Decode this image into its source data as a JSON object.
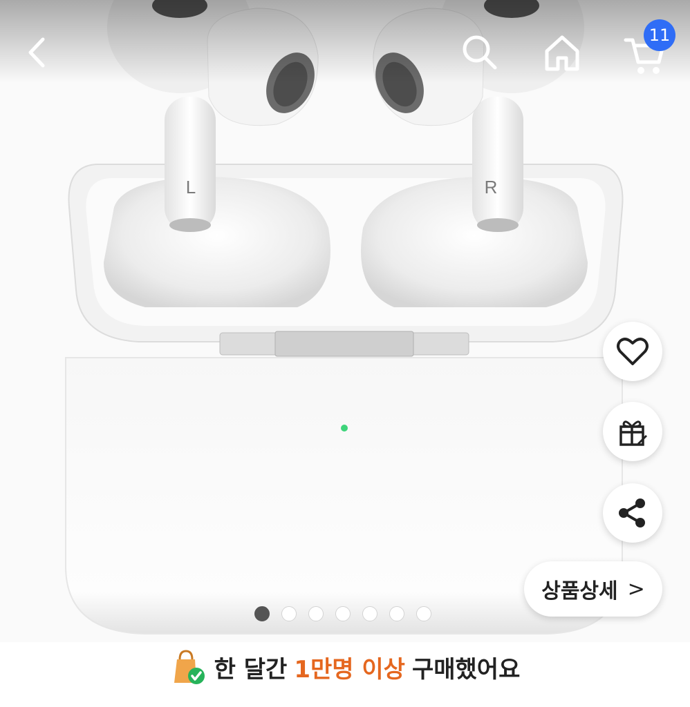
{
  "header": {
    "back_icon": "chevron-left-icon",
    "search_icon": "search-icon",
    "home_icon": "home-icon",
    "cart_icon": "cart-icon",
    "cart_count": "11"
  },
  "product_image": {
    "left_label": "L",
    "right_label": "R",
    "status_led_color": "#3ed47a"
  },
  "actions": {
    "wishlist_icon": "heart-icon",
    "gift_icon": "gift-icon",
    "share_icon": "share-icon",
    "detail_label": "상품상세",
    "detail_arrow": ">"
  },
  "carousel": {
    "total": 7,
    "active_index": 0
  },
  "banner": {
    "icon": "shopping-bag-check-icon",
    "prefix": "한 달간",
    "highlight": "1만명 이상",
    "suffix": "구매했어요",
    "highlight_color": "#e5671f"
  }
}
